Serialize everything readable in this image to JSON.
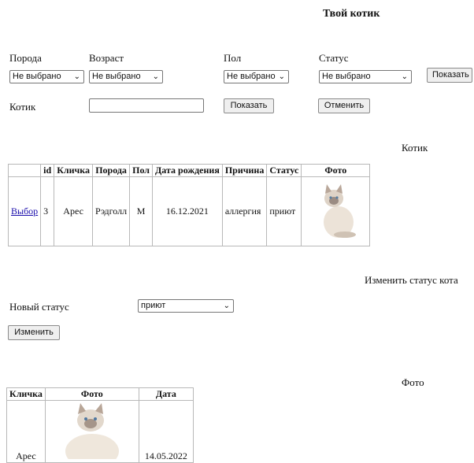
{
  "header": {
    "title": "Твой котик"
  },
  "filters": {
    "breed": {
      "label": "Порода",
      "value": "Не выбрано"
    },
    "age": {
      "label": "Возраст",
      "value": "Не выбрано"
    },
    "sex": {
      "label": "Пол",
      "value": "Не выбрано"
    },
    "status": {
      "label": "Статус",
      "value": "Не выбрано"
    },
    "show_label": "Показать"
  },
  "cat_search": {
    "label": "Котик",
    "value": "",
    "show_label": "Показать",
    "cancel_label": "Отменить"
  },
  "cat_section": {
    "title": "Котик",
    "columns": [
      "",
      "id",
      "Кличка",
      "Порода",
      "Пол",
      "Дата рождения",
      "Причина",
      "Статус",
      "Фото"
    ],
    "row": {
      "select": "Выбор",
      "id": "3",
      "name": "Арес",
      "breed": "Рэдголл",
      "sex": "М",
      "birth": "16.12.2021",
      "reason": "аллергия",
      "status": "приют"
    }
  },
  "status_section": {
    "title": "Изменить статус кота",
    "label": "Новый статус",
    "value": "приют",
    "change_label": "Изменить"
  },
  "photo_section": {
    "title": "Фото",
    "columns": [
      "Кличка",
      "Фото",
      "Дата"
    ],
    "row": {
      "name": "Арес",
      "date": "14.05.2022"
    }
  }
}
